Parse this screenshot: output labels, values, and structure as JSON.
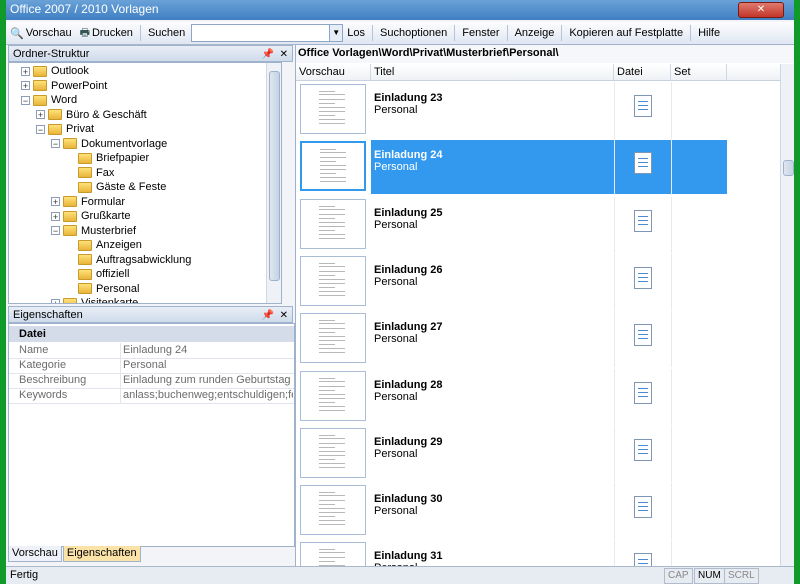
{
  "window": {
    "title": "Office 2007 / 2010 Vorlagen",
    "close_label": "✕"
  },
  "toolbar": {
    "preview": "Vorschau",
    "print": "Drucken",
    "search_label": "Suchen",
    "search_value": "",
    "go": "Los",
    "search_options": "Suchoptionen",
    "window": "Fenster",
    "view": "Anzeige",
    "copy": "Kopieren auf Festplatte",
    "help": "Hilfe"
  },
  "tree_pane": {
    "title": "Ordner-Struktur",
    "pin": "📌",
    "close": "✕"
  },
  "tree": [
    {
      "label": "Outlook",
      "level": 1,
      "exp": "+"
    },
    {
      "label": "PowerPoint",
      "level": 1,
      "exp": "+"
    },
    {
      "label": "Word",
      "level": 1,
      "exp": "−"
    },
    {
      "label": "Büro & Geschäft",
      "level": 2,
      "exp": "+"
    },
    {
      "label": "Privat",
      "level": 2,
      "exp": "−"
    },
    {
      "label": "Dokumentvorlage",
      "level": 3,
      "exp": "−"
    },
    {
      "label": "Briefpapier",
      "level": 4,
      "exp": ""
    },
    {
      "label": "Fax",
      "level": 4,
      "exp": ""
    },
    {
      "label": "Gäste & Feste",
      "level": 4,
      "exp": ""
    },
    {
      "label": "Formular",
      "level": 3,
      "exp": "+"
    },
    {
      "label": "Grußkarte",
      "level": 3,
      "exp": "+"
    },
    {
      "label": "Musterbrief",
      "level": 3,
      "exp": "−"
    },
    {
      "label": "Anzeigen",
      "level": 4,
      "exp": ""
    },
    {
      "label": "Auftragsabwicklung",
      "level": 4,
      "exp": ""
    },
    {
      "label": "offiziell",
      "level": 4,
      "exp": ""
    },
    {
      "label": "Personal",
      "level": 4,
      "exp": ""
    },
    {
      "label": "Visitenkarte",
      "level": 3,
      "exp": "+"
    }
  ],
  "props_pane": {
    "title": "Eigenschaften",
    "pin": "📌",
    "close": "✕"
  },
  "properties": {
    "category": "Datei",
    "rows": [
      {
        "key": "Name",
        "value": "Einladung 24"
      },
      {
        "key": "Kategorie",
        "value": "Personal"
      },
      {
        "key": "Beschreibung",
        "value": "Einladung zum runden Geburtstag (Rund"
      },
      {
        "key": "Keywords",
        "value": "anlass;buchenweg;entschuldigen;feier;f"
      }
    ]
  },
  "bottom_tabs": [
    "Vorschau",
    "Eigenschaften"
  ],
  "main": {
    "path": "Office Vorlagen\\Word\\Privat\\Musterbrief\\Personal\\",
    "columns": [
      "Vorschau",
      "Titel",
      "Datei",
      "Set"
    ],
    "selected_index": 1,
    "items": [
      {
        "title": "Einladung 23",
        "category": "Personal"
      },
      {
        "title": "Einladung 24",
        "category": "Personal"
      },
      {
        "title": "Einladung 25",
        "category": "Personal"
      },
      {
        "title": "Einladung 26",
        "category": "Personal"
      },
      {
        "title": "Einladung 27",
        "category": "Personal"
      },
      {
        "title": "Einladung 28",
        "category": "Personal"
      },
      {
        "title": "Einladung 29",
        "category": "Personal"
      },
      {
        "title": "Einladung 30",
        "category": "Personal"
      },
      {
        "title": "Einladung 31",
        "category": "Personal"
      }
    ]
  },
  "status": {
    "text": "Fertig",
    "cap": "CAP",
    "num": "NUM",
    "scrl": "SCRL"
  },
  "colors": {
    "selection": "#3399ee",
    "background": "#0f9a2a"
  }
}
